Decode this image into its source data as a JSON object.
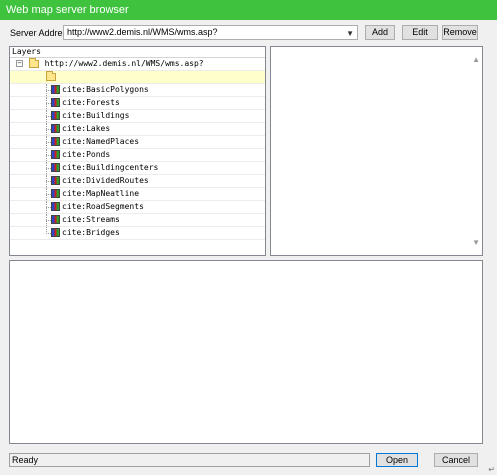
{
  "window": {
    "title": "Web map server browser"
  },
  "server": {
    "label": "Server Address:",
    "value": "http://www2.demis.nl/WMS/wms.asp?",
    "add_label": "Add",
    "edit_label": "Edit",
    "remove_label": "Remove"
  },
  "tree": {
    "header": "Layers",
    "root_label": "http://www2.demis.nl/WMS/wms.asp?",
    "expander_glyph": "−",
    "layers": [
      "cite:BasicPolygons",
      "cite:Forests",
      "cite:Buildings",
      "cite:Lakes",
      "cite:NamedPlaces",
      "cite:Ponds",
      "cite:Buildingcenters",
      "cite:DividedRoutes",
      "cite:MapNeatline",
      "cite:RoadSegments",
      "cite:Streams",
      "cite:Bridges"
    ]
  },
  "status": {
    "text": "Ready"
  },
  "footer": {
    "open_label": "Open",
    "cancel_label": "Cancel"
  },
  "colors": {
    "titlebar": "#3fc33f",
    "selected_row": "#ffffcc"
  }
}
